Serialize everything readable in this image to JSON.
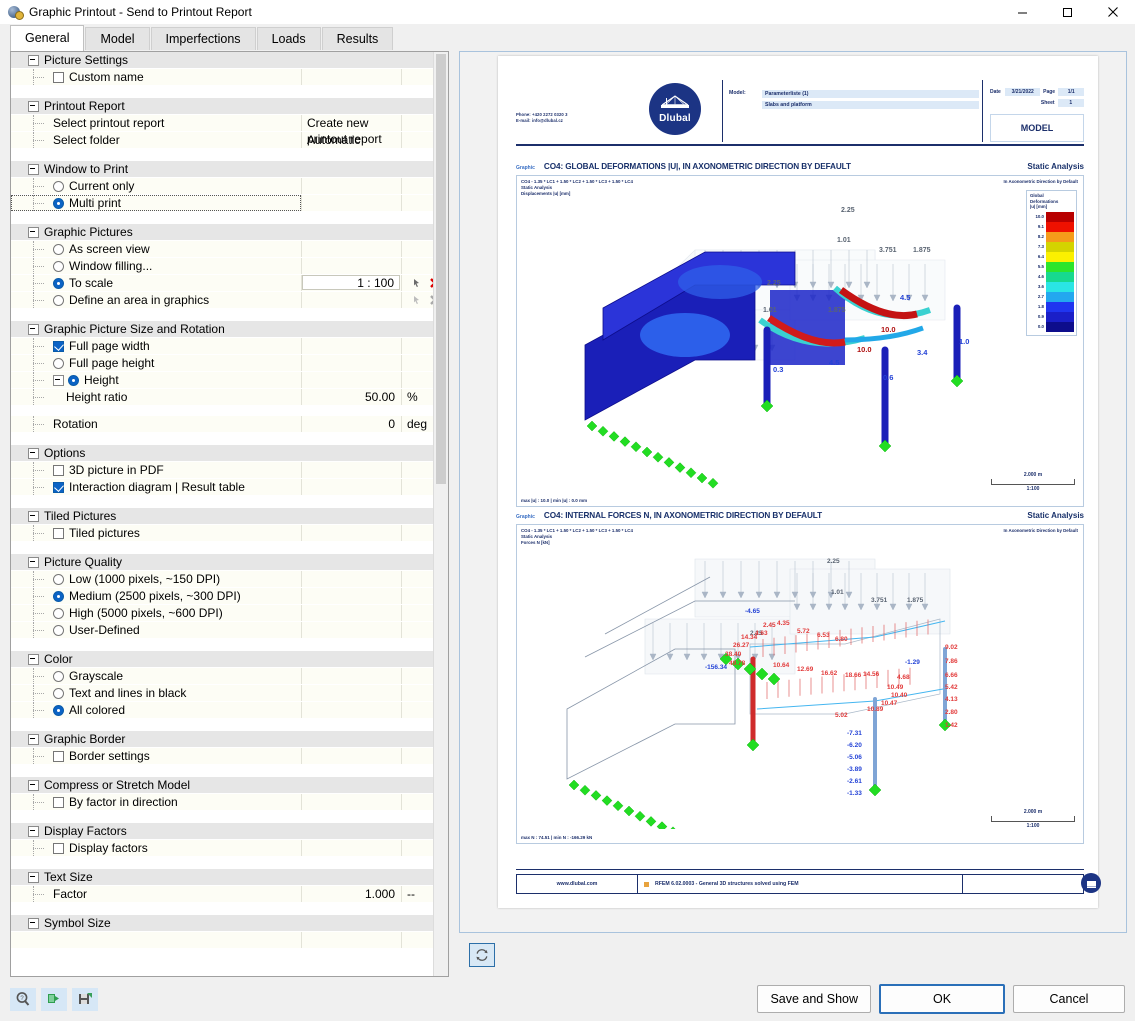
{
  "window": {
    "title": "Graphic Printout - Send to Printout Report",
    "icon": "app-icon",
    "minimize": "minimize-icon",
    "maximize": "maximize-icon",
    "close": "close-icon"
  },
  "tabs": [
    {
      "label": "General",
      "active": true
    },
    {
      "label": "Model",
      "active": false
    },
    {
      "label": "Imperfections",
      "active": false
    },
    {
      "label": "Loads",
      "active": false
    },
    {
      "label": "Results",
      "active": false
    }
  ],
  "groups": [
    {
      "title": "Picture Settings",
      "rows": [
        {
          "label": "Custom name",
          "control": "checkbox",
          "checked": false,
          "value": "",
          "unit": ""
        }
      ]
    },
    {
      "title": "Printout Report",
      "rows": [
        {
          "label": "Select printout report",
          "control": "none",
          "value": "Create new printout report",
          "unit": ""
        },
        {
          "label": "Select folder",
          "control": "none",
          "value": "Automatic",
          "unit": ""
        }
      ]
    },
    {
      "title": "Window to Print",
      "rows": [
        {
          "label": "Current only",
          "control": "radio",
          "checked": false,
          "value": "",
          "unit": ""
        },
        {
          "label": "Multi print",
          "control": "radio",
          "checked": true,
          "selected": true,
          "value": "",
          "unit": ""
        }
      ]
    },
    {
      "title": "Graphic Pictures",
      "rows": [
        {
          "label": "As screen view",
          "control": "radio",
          "checked": false,
          "value": "",
          "unit": ""
        },
        {
          "label": "Window filling...",
          "control": "radio",
          "checked": false,
          "value": "",
          "unit": ""
        },
        {
          "label": "To scale",
          "control": "radio",
          "checked": true,
          "value": "1 : 100",
          "unit": ""
        },
        {
          "label": "Define an area in graphics",
          "control": "radio",
          "checked": false,
          "value": "",
          "unit": ""
        }
      ]
    },
    {
      "title": "Graphic Picture Size and Rotation",
      "rows": [
        {
          "label": "Full page width",
          "control": "checkbox",
          "checked": true,
          "value": "",
          "unit": ""
        },
        {
          "label": "Full page height",
          "control": "radio",
          "checked": false,
          "value": "",
          "unit": ""
        },
        {
          "label": "Height",
          "control": "radio",
          "checked": true,
          "value": "",
          "unit": ""
        },
        {
          "label": "Height ratio",
          "control": "none",
          "value": "50.00",
          "unit": "%"
        },
        {
          "label": "Rotation",
          "control": "none",
          "value": "0",
          "unit": "deg"
        }
      ]
    },
    {
      "title": "Options",
      "rows": [
        {
          "label": "3D picture in PDF",
          "control": "checkbox",
          "checked": false,
          "value": "",
          "unit": ""
        },
        {
          "label": "Interaction diagram | Result table",
          "control": "checkbox",
          "checked": true,
          "value": "",
          "unit": ""
        }
      ]
    },
    {
      "title": "Tiled Pictures",
      "rows": [
        {
          "label": "Tiled pictures",
          "control": "checkbox",
          "checked": false,
          "value": "",
          "unit": ""
        }
      ]
    },
    {
      "title": "Picture Quality",
      "rows": [
        {
          "label": "Low (1000 pixels, ~150 DPI)",
          "control": "radio",
          "checked": false,
          "value": "",
          "unit": ""
        },
        {
          "label": "Medium (2500 pixels, ~300 DPI)",
          "control": "radio",
          "checked": true,
          "value": "",
          "unit": ""
        },
        {
          "label": "High (5000 pixels, ~600 DPI)",
          "control": "radio",
          "checked": false,
          "value": "",
          "unit": ""
        },
        {
          "label": "User-Defined",
          "control": "radio",
          "checked": false,
          "value": "",
          "unit": ""
        }
      ]
    },
    {
      "title": "Color",
      "rows": [
        {
          "label": "Grayscale",
          "control": "radio",
          "checked": false,
          "value": "",
          "unit": ""
        },
        {
          "label": "Text and lines in black",
          "control": "radio",
          "checked": false,
          "value": "",
          "unit": ""
        },
        {
          "label": "All colored",
          "control": "radio",
          "checked": true,
          "value": "",
          "unit": ""
        }
      ]
    },
    {
      "title": "Graphic Border",
      "rows": [
        {
          "label": "Border settings",
          "control": "checkbox",
          "checked": false,
          "value": "",
          "unit": ""
        }
      ]
    },
    {
      "title": "Compress or Stretch Model",
      "rows": [
        {
          "label": "By factor in direction",
          "control": "checkbox",
          "checked": false,
          "value": "",
          "unit": ""
        }
      ]
    },
    {
      "title": "Display Factors",
      "rows": [
        {
          "label": "Display factors",
          "control": "checkbox",
          "checked": false,
          "value": "",
          "unit": ""
        }
      ]
    },
    {
      "title": "Text Size",
      "rows": [
        {
          "label": "Factor",
          "control": "none",
          "value": "1.000",
          "unit": "--"
        }
      ]
    },
    {
      "title": "Symbol Size",
      "rows": []
    }
  ],
  "preview": {
    "refresh_icon": "refresh-icon",
    "report_header": {
      "phone": "Phone: +420 2272 0320 3",
      "email": "E-mail: info@dlubal.cz",
      "logo_text": "Dlubal",
      "model_key": "Model:",
      "model_value": "Parameterliste (1)",
      "model_desc": "Slabs and platform",
      "date_key": "Date",
      "date_value": "3/21/2022",
      "page_key": "Page",
      "page_value": "1/1",
      "sheet_key": "Sheet",
      "sheet_value": "1",
      "model_box": "MODEL"
    },
    "graphics": [
      {
        "tag": "Graphic",
        "title": "CO4: GLOBAL DEFORMATIONS |U|, IN AXONOMETRIC DIRECTION BY DEFAULT",
        "analysis": "Static Analysis",
        "meta": [
          "CO4 - 1.35 * LC1 + 1.50 * LC2 + 1.50 * LC3 + 1.50 * LC4",
          "Static Analysis",
          "Displacements |u| [mm]"
        ],
        "meta_right": "In Axonometric Direction by Default",
        "footer": "max |u| : 10.0 | min |u| : 0.0 mm",
        "scale_length": "2.000 m",
        "scale_ratio": "1:100",
        "legend": {
          "title": [
            "Global",
            "Deformations",
            "|u| [mm]"
          ],
          "entries": [
            {
              "value": "10.0",
              "color": "#b80000"
            },
            {
              "value": "9.1",
              "color": "#ef1100"
            },
            {
              "value": "8.2",
              "color": "#f59b1a"
            },
            {
              "value": "7.3",
              "color": "#d4d400"
            },
            {
              "value": "6.4",
              "color": "#fbf000"
            },
            {
              "value": "5.5",
              "color": "#2ce52c"
            },
            {
              "value": "4.6",
              "color": "#17d98f"
            },
            {
              "value": "3.6",
              "color": "#2ae5e5"
            },
            {
              "value": "2.7",
              "color": "#23a8ef"
            },
            {
              "value": "1.8",
              "color": "#1f35f0"
            },
            {
              "value": "0.9",
              "color": "#1a1fc8"
            },
            {
              "value": "0.0",
              "color": "#0d0d8c"
            }
          ]
        },
        "value_labels": [
          "2.25",
          "1.01",
          "3.751",
          "1.875",
          "2.25",
          "1.01",
          "1.875",
          "4.5",
          "10.0",
          "10.0",
          "4.5",
          "3.4",
          "1.0",
          "0.3",
          "0.6"
        ]
      },
      {
        "tag": "Graphic",
        "title": "CO4: INTERNAL FORCES N, IN AXONOMETRIC DIRECTION BY DEFAULT",
        "analysis": "Static Analysis",
        "meta": [
          "CO4 - 1.35 * LC1 + 1.50 * LC2 + 1.50 * LC3 + 1.50 * LC4",
          "Static Analysis",
          "Forces N [kN]"
        ],
        "meta_right": "In Axonometric Direction by Default",
        "footer": "max N : 74.51 | min N : -166.29 kN",
        "scale_length": "2.000 m",
        "scale_ratio": "1:100",
        "value_labels_red": [
          "2.45",
          "4.35",
          "4.63",
          "5.72",
          "6.53",
          "6.80",
          "14.34",
          "26.27",
          "38.40",
          "49.78",
          "10.64",
          "12.69",
          "16.62",
          "18.66",
          "14.56",
          "4.68",
          "10.49",
          "10.40",
          "10.47",
          "10.89",
          "5.02",
          "9.02",
          "7.86",
          "6.66",
          "5.42",
          "4.13",
          "2.80",
          "1.42"
        ],
        "value_labels_blue": [
          "-4.65",
          "-1.29",
          "-156.34",
          "-7.31",
          "-6.20",
          "-5.06",
          "-3.89",
          "-2.61",
          "-1.33"
        ],
        "value_labels_gray": [
          "2.25",
          "1.01",
          "3.751",
          "1.875",
          "2.25"
        ]
      }
    ],
    "page_footer": {
      "website": "www.dlubal.com",
      "program": "RFEM 6.02.0003 - General 3D structures solved using FEM"
    }
  },
  "toolbar": {
    "help_icon": "help-icon",
    "export_icon": "export-icon",
    "save_icon": "save-settings-icon"
  },
  "buttons": {
    "save_and_show": "Save and Show",
    "ok": "OK",
    "cancel": "Cancel"
  }
}
